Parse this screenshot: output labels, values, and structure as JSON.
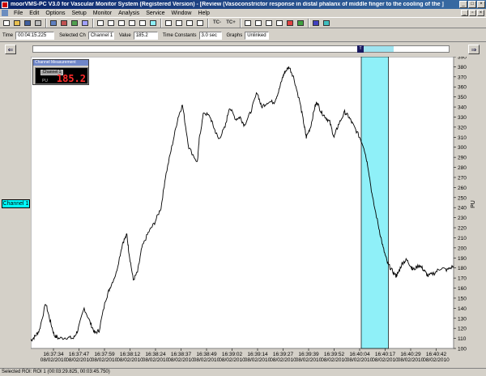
{
  "window": {
    "title": "moorVMS-PC V3.0 for Vascular Monitor System (Registered Version) - [Review (Vasoconstrictor response in distal phalanx of middle finger to the cooling of the ]"
  },
  "menu": {
    "items": [
      "File",
      "Edit",
      "Options",
      "Setup",
      "Monitor",
      "Analysis",
      "Service",
      "Window",
      "Help"
    ]
  },
  "toolbar": {
    "tc_minus": "TC-",
    "tc_plus": "TC+"
  },
  "fields": {
    "time_label": "Time",
    "time_value": "00:04:15.225",
    "selected_ch_label": "Selected Ch",
    "selected_ch_value": "Channel 1",
    "value_label": "Value",
    "value_value": "185.2",
    "time_constants_label": "Time Constants",
    "time_constants_value": "3.0 sec",
    "graphs_label": "Graphs",
    "graphs_value": "Unlinked"
  },
  "scrollbar": {
    "thumb_glyph": "T"
  },
  "left_panel": {
    "channel_label": "Channel 1"
  },
  "float_window": {
    "title": "Channel Measurement",
    "channel": "Channel 1",
    "unit": "PU",
    "value": "185.2"
  },
  "status": {
    "text": "Selected ROI: ROI 1 (00:03:29.825, 00:03:45.750)"
  },
  "colors": {
    "roi": "#8ff0f8",
    "trace": "#000000",
    "accent_value": "#ff2a2a"
  },
  "chart_data": {
    "type": "line",
    "ylabel": "PU",
    "ylim": [
      100,
      390
    ],
    "yticks": [
      100,
      110,
      120,
      130,
      140,
      150,
      160,
      170,
      180,
      190,
      200,
      210,
      220,
      230,
      240,
      250,
      260,
      270,
      280,
      290,
      300,
      310,
      320,
      330,
      340,
      350,
      360,
      370,
      380,
      390
    ],
    "x_tick_labels": [
      "16:37:34",
      "16:37:47",
      "16:37:59",
      "16:38:12",
      "16:38:24",
      "16:38:37",
      "16:38:49",
      "16:39:02",
      "16:39:14",
      "16:39:27",
      "16:39:39",
      "16:39:52",
      "16:40:04",
      "16:40:17",
      "16:40:29",
      "16:40:42"
    ],
    "x_date_label": "08/02/2010",
    "roi": {
      "start": "16:40:04",
      "end": "16:40:17"
    },
    "series": [
      {
        "t": [
          0,
          2,
          4,
          7,
          9,
          11,
          13,
          17,
          20,
          22,
          25,
          28,
          30,
          32,
          35,
          37,
          40,
          43,
          45,
          46,
          48,
          50,
          52,
          55,
          58,
          61,
          63,
          66,
          69,
          71,
          74,
          78,
          79,
          81,
          84,
          86,
          88,
          91,
          93,
          96,
          98,
          100,
          103,
          106,
          108,
          111,
          114,
          116,
          118,
          119,
          121,
          123,
          126,
          128,
          129,
          131,
          133,
          134,
          136,
          138,
          140,
          142,
          144,
          147,
          149,
          151,
          154,
          156,
          158,
          160,
          163,
          165,
          167,
          169,
          171,
          172,
          174,
          176,
          178,
          179,
          182,
          184,
          186,
          189,
          192,
          195,
          198
        ],
        "v": [
          108,
          112,
          118,
          145,
          128,
          113,
          110,
          111,
          110,
          118,
          140,
          125,
          115,
          118,
          148,
          160,
          175,
          205,
          213,
          195,
          168,
          176,
          200,
          215,
          225,
          240,
          270,
          300,
          330,
          342,
          300,
          285,
          310,
          335,
          330,
          318,
          308,
          320,
          340,
          328,
          330,
          322,
          335,
          355,
          340,
          345,
          345,
          355,
          370,
          375,
          380,
          370,
          345,
          322,
          310,
          320,
          340,
          345,
          335,
          330,
          325,
          310,
          322,
          335,
          330,
          322,
          310,
          300,
          280,
          250,
          220,
          200,
          185,
          178,
          172,
          175,
          185,
          188,
          182,
          178,
          183,
          178,
          172,
          175,
          180,
          178,
          182
        ]
      }
    ]
  }
}
